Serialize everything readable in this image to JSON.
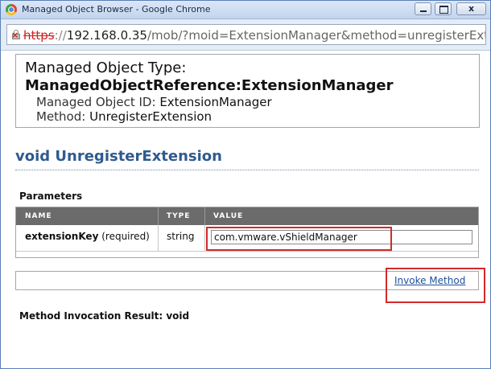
{
  "window": {
    "title": "Managed Object Browser - Google Chrome",
    "controls": {
      "minimize": "",
      "maximize": "",
      "close": "x"
    }
  },
  "address": {
    "scheme": "https",
    "separator": "://",
    "host": "192.168.0.35",
    "path": "/mob/?moid=ExtensionManager&method=unregisterExtens"
  },
  "header": {
    "type_label": "Managed Object Type:",
    "type_value": "ManagedObjectReference:ExtensionManager",
    "id_label": "Managed Object ID:",
    "id_value": "ExtensionManager",
    "method_label": "Method:",
    "method_value": "UnregisterExtension"
  },
  "method_title": "void UnregisterExtension",
  "parameters": {
    "title": "Parameters",
    "columns": [
      "NAME",
      "TYPE",
      "VALUE"
    ],
    "rows": [
      {
        "name": "extensionKey",
        "qualifier": "(required)",
        "type": "string",
        "value": "com.vmware.vShieldManager"
      }
    ]
  },
  "invoke": {
    "label": "Invoke Method"
  },
  "result": "Method Invocation Result: void",
  "colors": {
    "highlight": "#d12b2b",
    "heading": "#2f5a8f",
    "link": "#1d4f9a",
    "table_header": "#6b6b6b"
  }
}
